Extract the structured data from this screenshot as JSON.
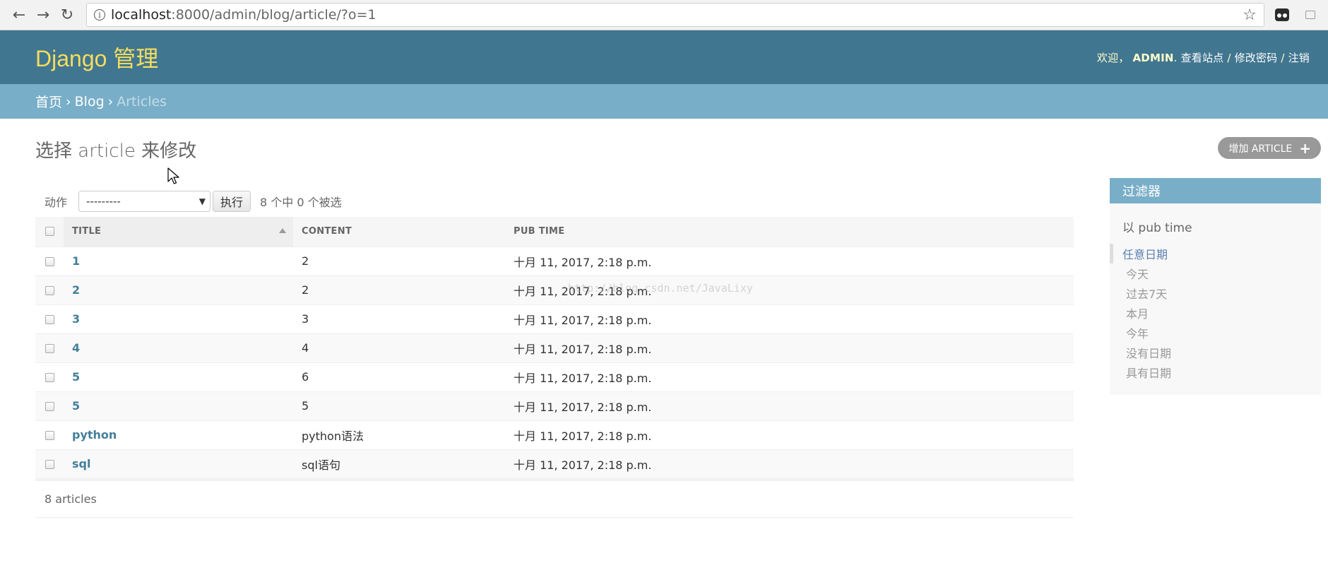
{
  "browser": {
    "url_host": "localhost",
    "url_path": ":8000/admin/blog/article/?o=1"
  },
  "header": {
    "branding": "Django 管理",
    "welcome": "欢迎，",
    "username": "ADMIN",
    "view_site": "查看站点",
    "change_password": "修改密码",
    "logout": "注销",
    "sep": " / "
  },
  "breadcrumbs": {
    "home": "首页",
    "app": "Blog",
    "model": "Articles",
    "sep": "›"
  },
  "page": {
    "title": "选择 article 来修改",
    "add_button": "增加 ARTICLE"
  },
  "actions": {
    "label": "动作",
    "selected_option": "---------",
    "go_button": "执行",
    "counter": "8 个中 0 个被选"
  },
  "table": {
    "headers": [
      "TITLE",
      "CONTENT",
      "PUB TIME"
    ],
    "rows": [
      {
        "title": "1",
        "content": "2",
        "pub_time": "十月 11, 2017, 2:18 p.m."
      },
      {
        "title": "2",
        "content": "2",
        "pub_time": "十月 11, 2017, 2:18 p.m."
      },
      {
        "title": "3",
        "content": "3",
        "pub_time": "十月 11, 2017, 2:18 p.m."
      },
      {
        "title": "4",
        "content": "4",
        "pub_time": "十月 11, 2017, 2:18 p.m."
      },
      {
        "title": "5",
        "content": "6",
        "pub_time": "十月 11, 2017, 2:18 p.m."
      },
      {
        "title": "5",
        "content": "5",
        "pub_time": "十月 11, 2017, 2:18 p.m."
      },
      {
        "title": "python",
        "content": "python语法",
        "pub_time": "十月 11, 2017, 2:18 p.m."
      },
      {
        "title": "sql",
        "content": "sql语句",
        "pub_time": "十月 11, 2017, 2:18 p.m."
      }
    ]
  },
  "paginator": "8 articles",
  "filter": {
    "title": "过滤器",
    "subtitle": "以 pub time",
    "options": [
      "任意日期",
      "今天",
      "过去7天",
      "本月",
      "今年",
      "没有日期",
      "具有日期"
    ],
    "selected_index": 0
  },
  "watermark": "http://blog.csdn.net/JavaLixy",
  "colors": {
    "header_bg": "#417690",
    "branding": "#f5dd5d",
    "breadcrumbs_bg": "#79aec8",
    "link": "#447e9b"
  }
}
